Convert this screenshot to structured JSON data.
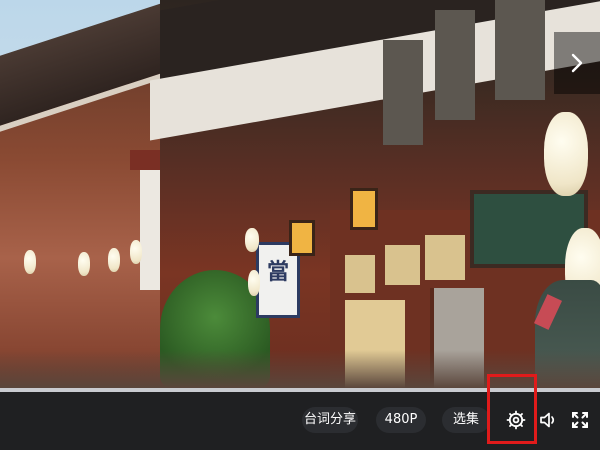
{
  "video": {
    "sign_text": "當"
  },
  "controls": {
    "subtitle_share_label": "台词分享",
    "quality_label": "480P",
    "episodes_label": "选集"
  },
  "icons": {
    "next": "chevron-right-icon",
    "settings": "gear-icon",
    "volume": "speaker-icon",
    "fullscreen": "fullscreen-icon"
  },
  "colors": {
    "control_bar_bg": "#1f2022",
    "pill_bg": "#2b2d31",
    "highlight": "#e01b1b"
  }
}
